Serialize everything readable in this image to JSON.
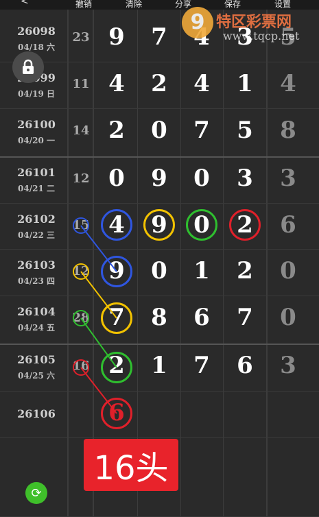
{
  "toolbar": {
    "back": "<",
    "undo": "撤销",
    "clear": "清除",
    "share": "分享",
    "save": "保存",
    "settings": "设置"
  },
  "watermark": {
    "logo": "9",
    "name": "特区彩票网",
    "url": "www.tqcp.net"
  },
  "rows": [
    {
      "issue": "26098",
      "date": "04/18 六",
      "sum": "23",
      "digits": [
        "9",
        "7",
        "4",
        "3"
      ],
      "last": "5"
    },
    {
      "issue": "26099",
      "date": "04/19 日",
      "sum": "11",
      "digits": [
        "4",
        "2",
        "4",
        "1"
      ],
      "last": "4"
    },
    {
      "issue": "26100",
      "date": "04/20 一",
      "sum": "14",
      "digits": [
        "2",
        "0",
        "7",
        "5"
      ],
      "last": "8"
    },
    {
      "issue": "26101",
      "date": "04/21 二",
      "sum": "12",
      "digits": [
        "0",
        "9",
        "0",
        "3"
      ],
      "last": "3"
    },
    {
      "issue": "26102",
      "date": "04/22 三",
      "sum": "15",
      "digits": [
        "4",
        "9",
        "0",
        "2"
      ],
      "last": "6"
    },
    {
      "issue": "26103",
      "date": "04/23 四",
      "sum": "12",
      "digits": [
        "9",
        "0",
        "1",
        "2"
      ],
      "last": "0"
    },
    {
      "issue": "26104",
      "date": "04/24 五",
      "sum": "28",
      "digits": [
        "7",
        "8",
        "6",
        "7"
      ],
      "last": "0"
    },
    {
      "issue": "26105",
      "date": "04/25 六",
      "sum": "16",
      "digits": [
        "2",
        "1",
        "7",
        "6"
      ],
      "last": "3"
    },
    {
      "issue": "26106",
      "date": "",
      "sum": "",
      "digits": [
        "6",
        "",
        "",
        ""
      ],
      "last": ""
    }
  ],
  "badge": "16头",
  "colors": {
    "blue": "#2f56e0",
    "yellow": "#f2c200",
    "green": "#2fbf2f",
    "red": "#e0202a"
  }
}
